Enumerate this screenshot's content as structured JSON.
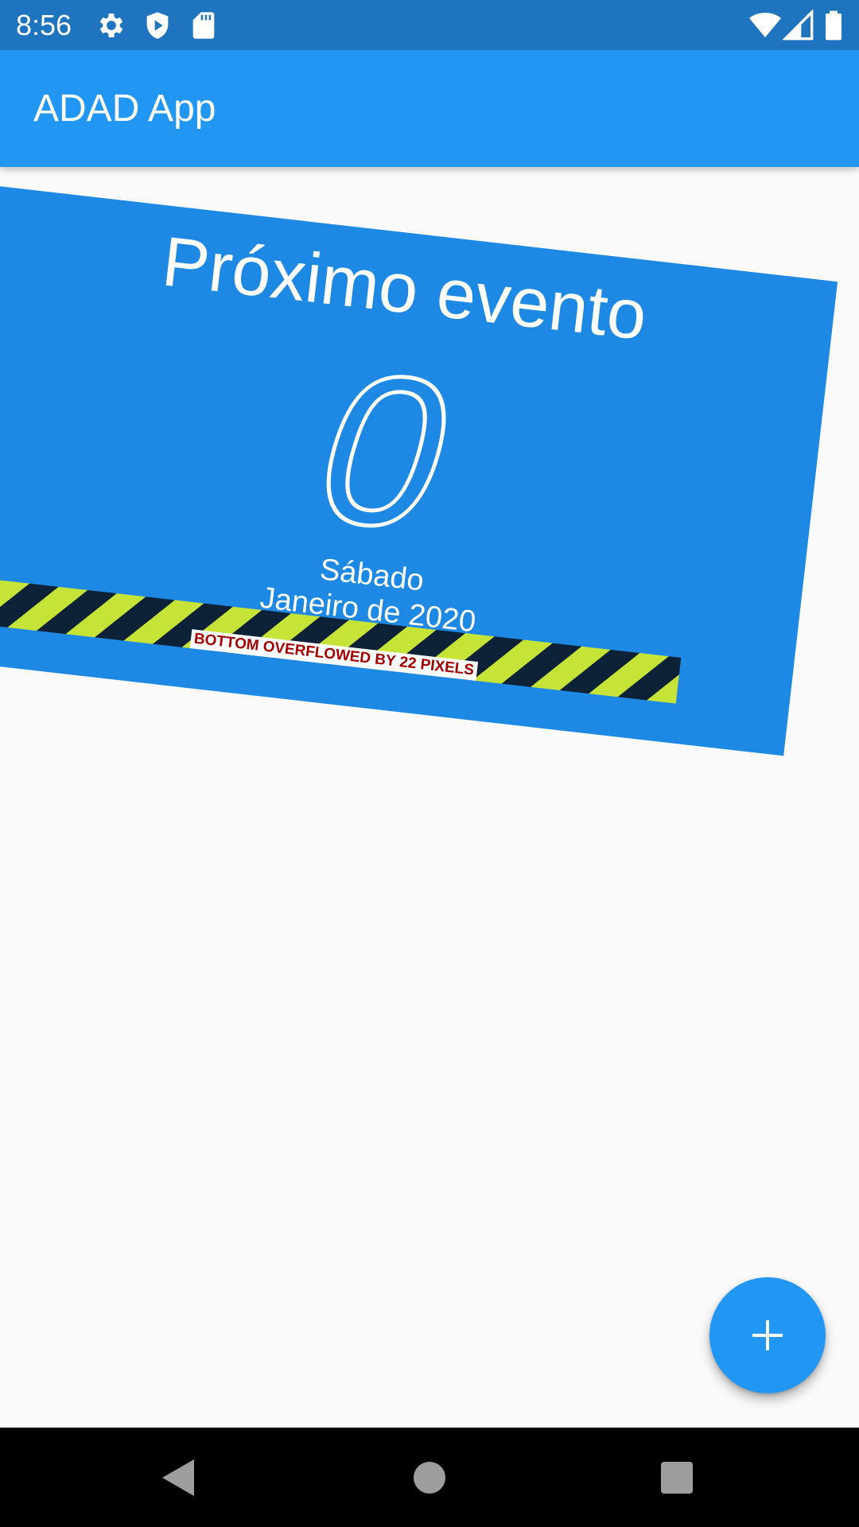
{
  "status_bar": {
    "time": "8:56",
    "left_icons": [
      "gear-icon",
      "shield-play-icon",
      "sd-card-icon"
    ],
    "right_icons": [
      "wifi-icon",
      "signal-icon",
      "battery-icon"
    ]
  },
  "app_bar": {
    "title": "ADAD App"
  },
  "event_card": {
    "title": "Próximo evento",
    "count": "0",
    "weekday": "Sábado",
    "month_year": "Janeiro de 2020",
    "overflow_warning": "BOTTOM OVERFLOWED BY 22 PIXELS"
  },
  "fab": {
    "icon": "plus-icon"
  },
  "nav_bar": {
    "buttons": [
      "back-icon",
      "home-icon",
      "recents-icon"
    ]
  },
  "colors": {
    "status_bar": "#1e74bf",
    "app_bar": "#2196f3",
    "card": "#1e88e5",
    "background": "#fafafa",
    "warning_yellow": "#c6e338",
    "warning_dark": "#0d2137",
    "warning_text": "#a50000"
  }
}
